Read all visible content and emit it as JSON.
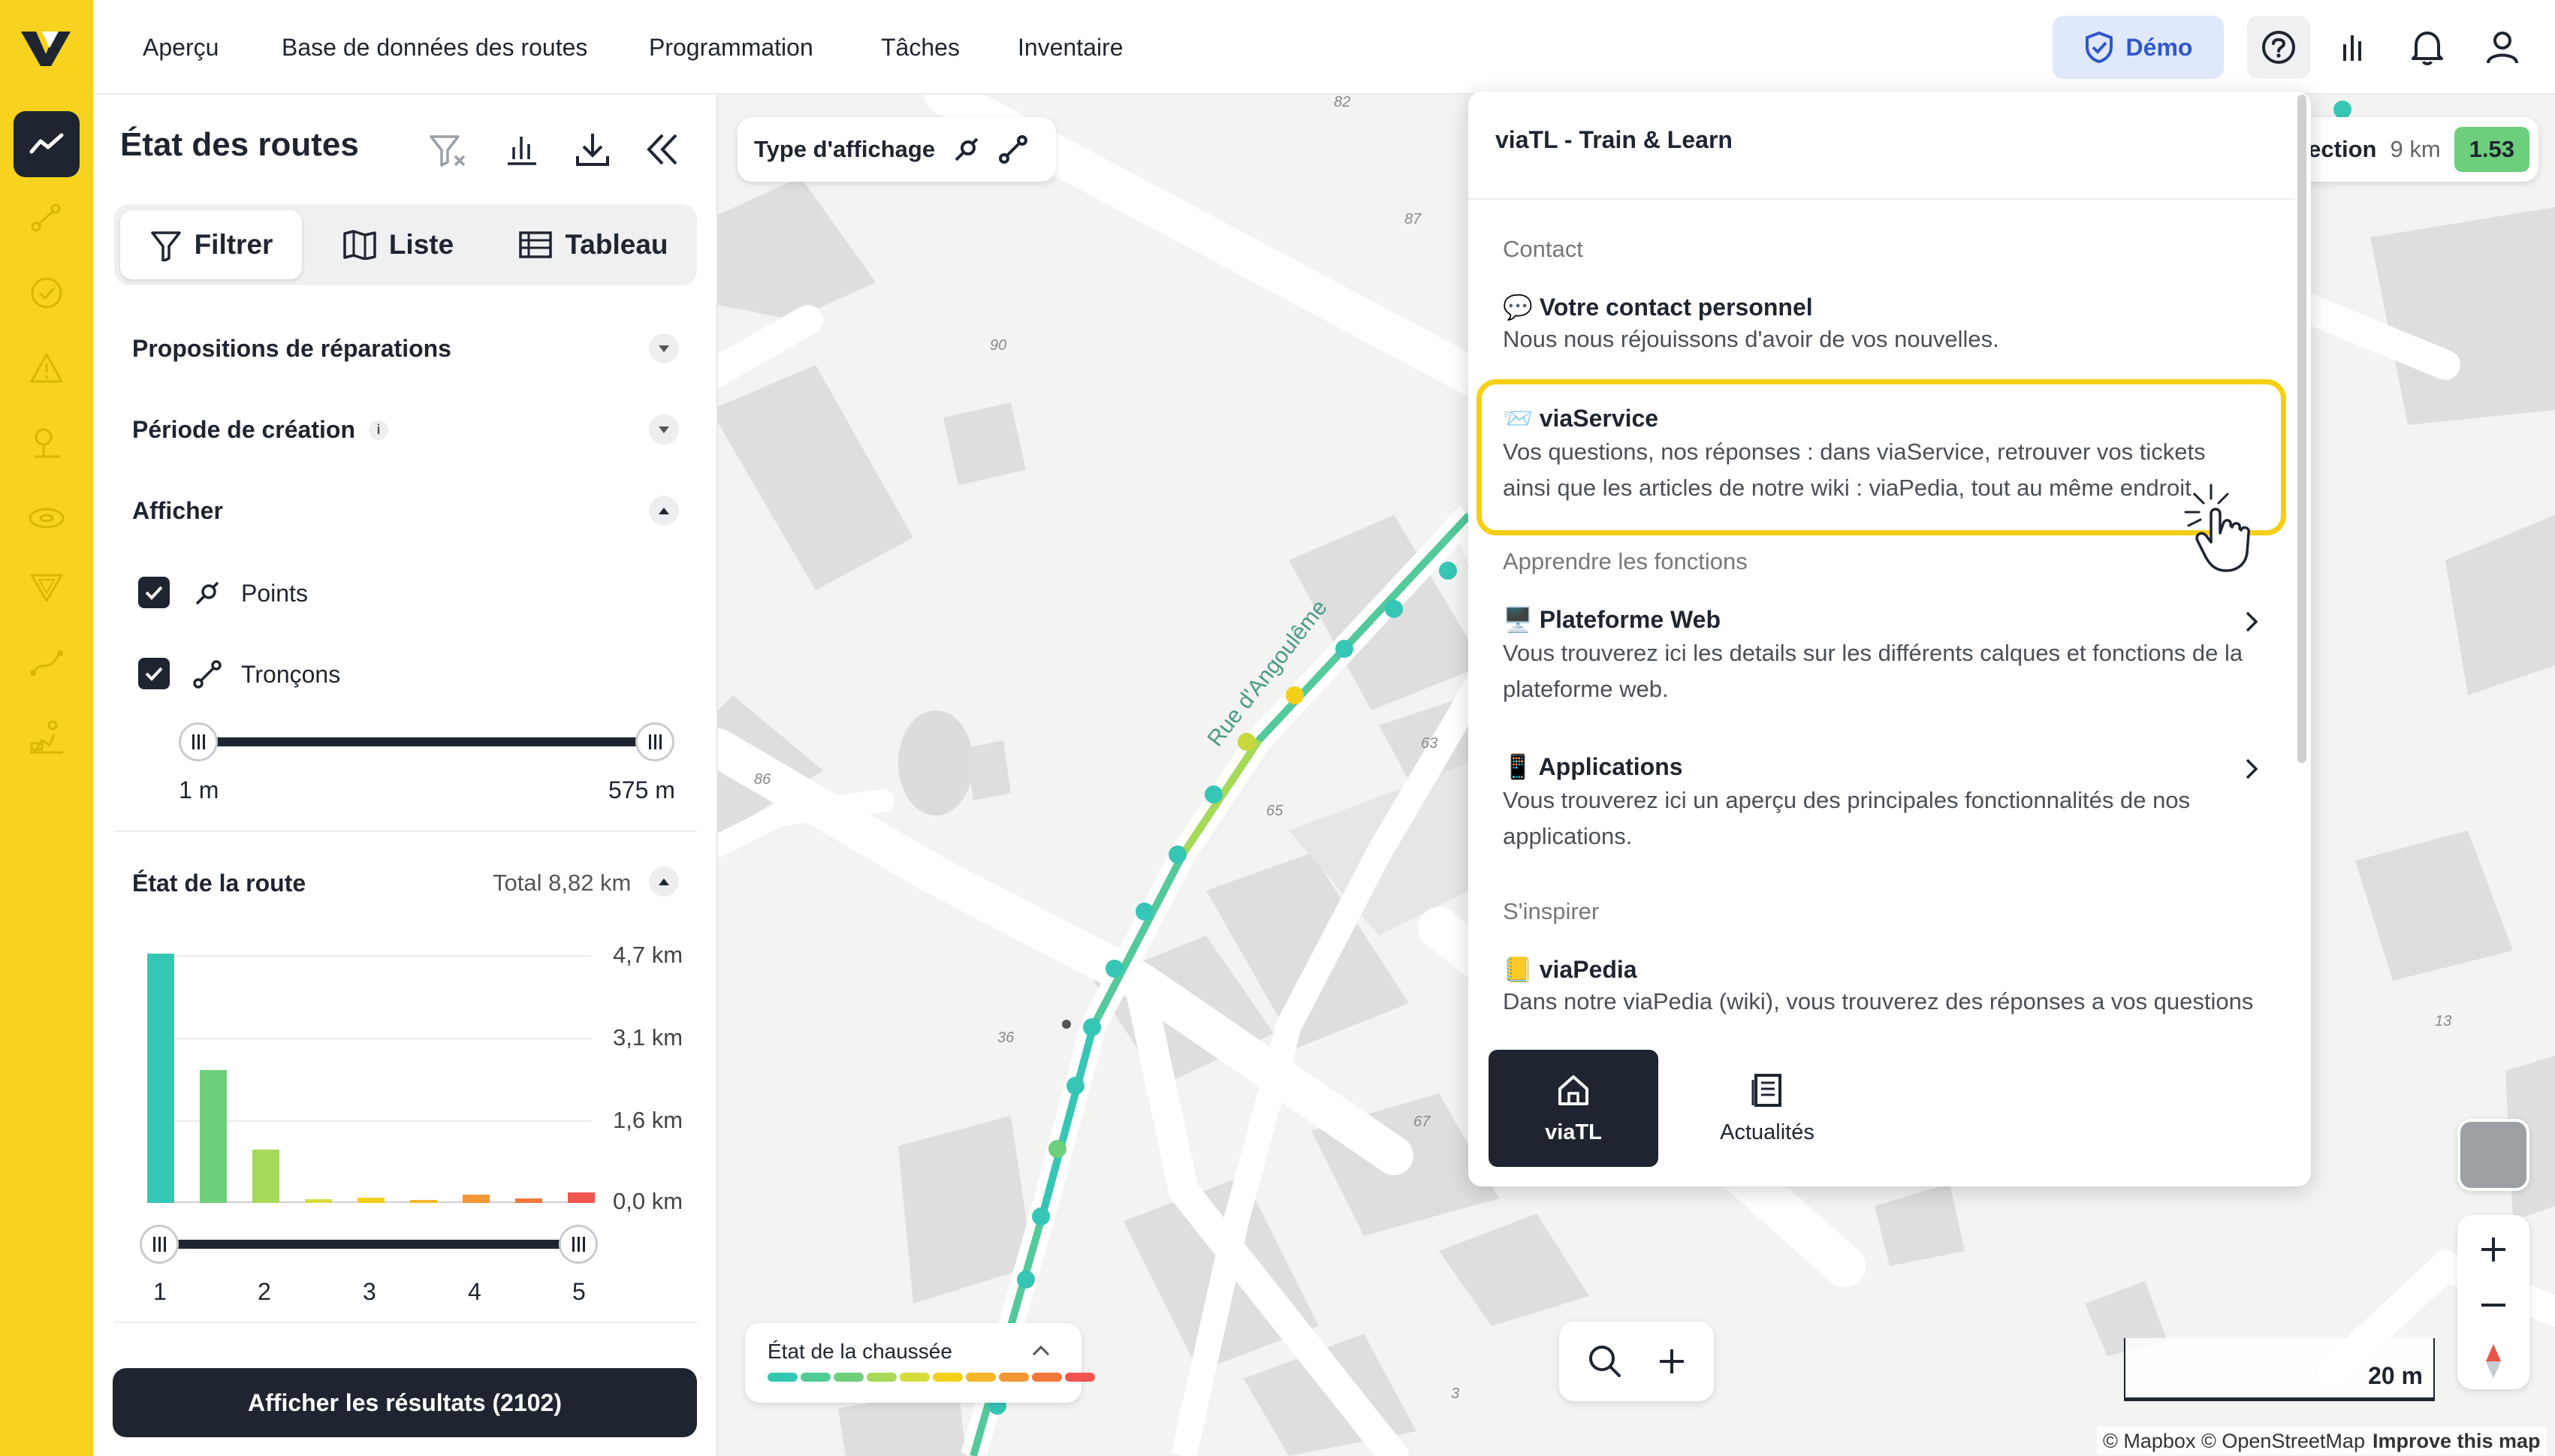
{
  "nav": {
    "items": [
      "Aperçu",
      "Base de données des routes",
      "Programmation",
      "Tâches",
      "Inventaire"
    ],
    "demo_label": "Démo"
  },
  "rail": {
    "icons": [
      "trend-icon",
      "route-nodes-icon",
      "check-circle-icon",
      "warning-icon",
      "tree-icon",
      "disc-icon",
      "yield-sign-icon",
      "path-icon",
      "worker-icon"
    ]
  },
  "sidebar": {
    "title": "État des routes",
    "segments": [
      "Filtrer",
      "Liste",
      "Tableau"
    ],
    "accordions": {
      "repairs": "Propositions de réparations",
      "period": "Période de création",
      "display": "Afficher"
    },
    "checkboxes": [
      "Points",
      "Tronçons"
    ],
    "length_range": {
      "min": "1 m",
      "max": "575 m"
    },
    "road_state": {
      "title": "État de la route",
      "total": "Total 8,82 km"
    },
    "cta": "Afficher les résultats (2102)"
  },
  "chart_data": {
    "type": "bar",
    "categories": [
      "1",
      "",
      "2",
      "",
      "3",
      "",
      "4",
      "",
      "5"
    ],
    "values": [
      4.7,
      2.5,
      1.0,
      0.07,
      0.1,
      0.05,
      0.15,
      0.09,
      0.2
    ],
    "colors": [
      "#34c8b4",
      "#6dcf7b",
      "#a6d957",
      "#d3dc3b",
      "#f4cf1a",
      "#f5b62b",
      "#f39633",
      "#f3763a",
      "#f05550"
    ],
    "y_ticks": [
      "4,7 km",
      "3,1 km",
      "1,6 km",
      "0,0 km"
    ],
    "ylim": [
      0,
      4.7
    ],
    "x_ticks": [
      "1",
      "2",
      "3",
      "4",
      "5"
    ]
  },
  "map": {
    "display_type": "Type d'affichage",
    "street": "Rue d'Angoulême",
    "numbers": [
      "82",
      "87",
      "90",
      "86",
      "63",
      "65",
      "36",
      "67",
      "3",
      "13"
    ],
    "section_label": "ection",
    "section_km": "9 km",
    "section_value": "1.53",
    "legend_label": "État de la chaussée",
    "scale": "20 m",
    "attribution": "© Mapbox © OpenStreetMap",
    "improve": "Improve this map"
  },
  "popup": {
    "title": "viaTL - Train & Learn",
    "sec_contact": "Contact",
    "contact_head": "💬 Votre contact personnel",
    "contact_body": "Nous nous réjouissons d'avoir de vos nouvelles.",
    "service_head": "📨 viaService",
    "service_body": "Vos questions, nos réponses : dans viaService, retrouver vos tickets ainsi que les articles de notre wiki : viaPedia, tout au même endroit.",
    "sec_learn": "Apprendre les fonctions",
    "web_head": "🖥️ Plateforme Web",
    "web_body": "Vous trouverez ici les details sur les différents calques et fonctions de la plateforme web.",
    "apps_head": "📱 Applications",
    "apps_body": "Vous trouverez ici un aperçu des principales fonctionnalités de nos applications.",
    "sec_inspire": "S'inspirer",
    "wiki_head": "📒 viaPedia",
    "wiki_body": "Dans notre viaPedia (wiki), vous trouverez des réponses a vos questions",
    "tab_home": "viaTL",
    "tab_news": "Actualités"
  },
  "colors": {
    "accent": "#f7d21e",
    "dark": "#1e2530",
    "demo_bg": "#dfe9fb",
    "demo_text": "#3157c9",
    "route": "#34c8b4"
  }
}
